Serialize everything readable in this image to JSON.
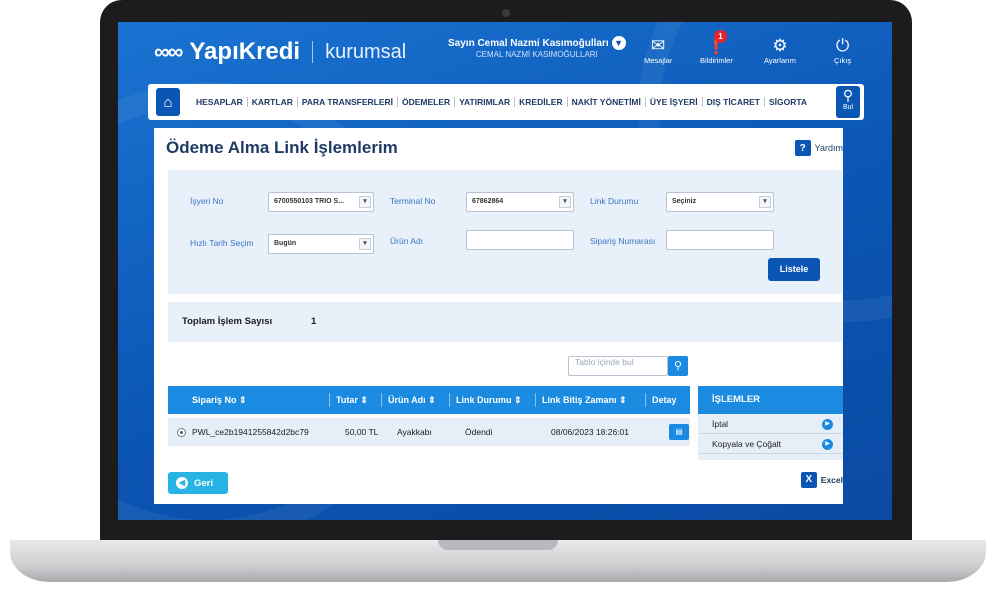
{
  "brand": {
    "name": "YapıKredi",
    "sub": "kurumsal"
  },
  "user": {
    "greeting": "Sayın Cemal Nazmi Kasımoğulları",
    "company": "CEMAL NAZMİ KASIMOĞULLARI"
  },
  "top_icons": [
    {
      "label": "Mesajlar",
      "icon": "envelope-icon"
    },
    {
      "label": "Bildirimler",
      "icon": "alert-icon",
      "badge": "1"
    },
    {
      "label": "Ayarlarım",
      "icon": "gear-icon"
    },
    {
      "label": "Çıkış",
      "icon": "power-icon"
    }
  ],
  "nav": {
    "items": [
      "HESAPLAR",
      "KARTLAR",
      "PARA TRANSFERLERİ",
      "ÖDEMELER",
      "YATIRIMLAR",
      "KREDİLER",
      "NAKİT YÖNETİMİ",
      "ÜYE İŞYERİ",
      "DIŞ TİCARET",
      "SİGORTA"
    ],
    "search_label": "Bul"
  },
  "page": {
    "title": "Ödeme Alma Link İşlemlerim",
    "help": "Yardım"
  },
  "filters": {
    "merchant_label": "İşyeri No",
    "merchant_value": "6700550103 TRIO S...",
    "terminal_label": "Terminal No",
    "terminal_value": "67862864",
    "link_status_label": "Link Durumu",
    "link_status_value": "Seçiniz",
    "quick_date_label": "Hızlı Tarih Seçim",
    "quick_date_value": "Bugün",
    "product_label": "Ürün Adı",
    "order_label": "Sipariş Numarası",
    "list_button": "Listele"
  },
  "summary": {
    "label": "Toplam İşlem Sayısı",
    "value": "1"
  },
  "table": {
    "search_placeholder": "Tablo içinde bul",
    "headers": [
      "Sipariş No ⇕",
      "Tutar ⇕",
      "Ürün Adı ⇕",
      "Link Durumu ⇕",
      "Link Bitiş Zamanı ⇕",
      "Detay"
    ],
    "rows": [
      {
        "order_no": "PWL_ce2b1941255842d2bc79",
        "amount": "50,00 TL",
        "product": "Ayakkabı",
        "status": "Ödendi",
        "end_time": "08/06/2023 18:26:01"
      }
    ]
  },
  "operations": {
    "title": "İŞLEMLER",
    "items": [
      "İptal",
      "Kopyala ve Çoğalt"
    ]
  },
  "footer": {
    "back": "Geri",
    "excel": "Excel"
  }
}
